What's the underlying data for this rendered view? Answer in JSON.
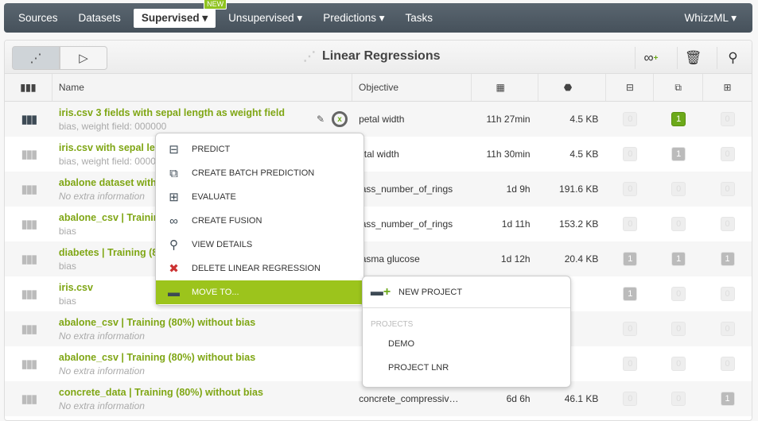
{
  "nav": {
    "items": [
      "Sources",
      "Datasets",
      "Supervised ▾",
      "Unsupervised ▾",
      "Predictions ▾",
      "Tasks"
    ],
    "badge": "NEW",
    "right": "WhizzML ▾"
  },
  "toolbar": {
    "title": "Linear Regressions",
    "icons": [
      "linear-regression-view-icon",
      "tree-view-icon",
      "fusion-add-icon",
      "trash-icon",
      "search-icon"
    ]
  },
  "columns": {
    "name": "Name",
    "objective": "Objective",
    "icons": [
      "calendar-icon",
      "size-weight-icon",
      "predictions-icon",
      "batch-predictions-icon",
      "evaluations-icon"
    ]
  },
  "rows": [
    {
      "name": "iris.csv 3 fields with sepal length as weight field",
      "info": "bias, weight field: 000000",
      "objective": "petal width",
      "age": "11h 27min",
      "size": "4.5 KB",
      "c1": "0",
      "c2": "1",
      "c3": "0"
    },
    {
      "name": "iris.csv with sepal len",
      "info": "bias, weight field: 0000",
      "objective": "etal width",
      "age": "11h 30min",
      "size": "4.5 KB",
      "c1": "0",
      "c2": "1",
      "c3": "0"
    },
    {
      "name": "abalone dataset witho",
      "info": "No extra information",
      "objective": "lass_number_of_rings",
      "age": "1d 9h",
      "size": "191.6 KB",
      "c1": "0",
      "c2": "0",
      "c3": "0"
    },
    {
      "name": "abalone_csv | Training",
      "info": "bias",
      "objective": "lass_number_of_rings",
      "age": "1d 11h",
      "size": "153.2 KB",
      "c1": "0",
      "c2": "0",
      "c3": "0"
    },
    {
      "name": "diabetes | Training (80",
      "info": "bias",
      "objective": "lasma glucose",
      "age": "1d 12h",
      "size": "20.4 KB",
      "c1": "1",
      "c2": "1",
      "c3": "1"
    },
    {
      "name": "iris.csv",
      "info": "bias",
      "objective": "",
      "age": "",
      "size": "",
      "c1": "1",
      "c2": "0",
      "c3": "0"
    },
    {
      "name": "abalone_csv | Training (80%) without bias",
      "info": "No extra information",
      "objective": "",
      "age": "",
      "size": "",
      "c1": "0",
      "c2": "0",
      "c3": "0"
    },
    {
      "name": "abalone_csv | Training (80%) without bias",
      "info": "No extra information",
      "objective": "",
      "age": "",
      "size": "",
      "c1": "0",
      "c2": "0",
      "c3": "0"
    },
    {
      "name": "concrete_data | Training (80%) without bias",
      "info": "No extra information",
      "objective": "concrete_compressiv…",
      "age": "6d 6h",
      "size": "46.1 KB",
      "c1": "0",
      "c2": "0",
      "c3": "1"
    }
  ],
  "menu": {
    "items": [
      "PREDICT",
      "CREATE BATCH PREDICTION",
      "EVALUATE",
      "CREATE FUSION",
      "VIEW DETAILS",
      "DELETE LINEAR REGRESSION",
      "MOVE TO..."
    ]
  },
  "submenu": {
    "new_project": "NEW PROJECT",
    "label": "PROJECTS",
    "projects": [
      "DEMO",
      "PROJECT LNR"
    ]
  },
  "colors": {
    "accent": "#9cc41c",
    "link": "#7fa614",
    "nav": "#4f5a64"
  }
}
